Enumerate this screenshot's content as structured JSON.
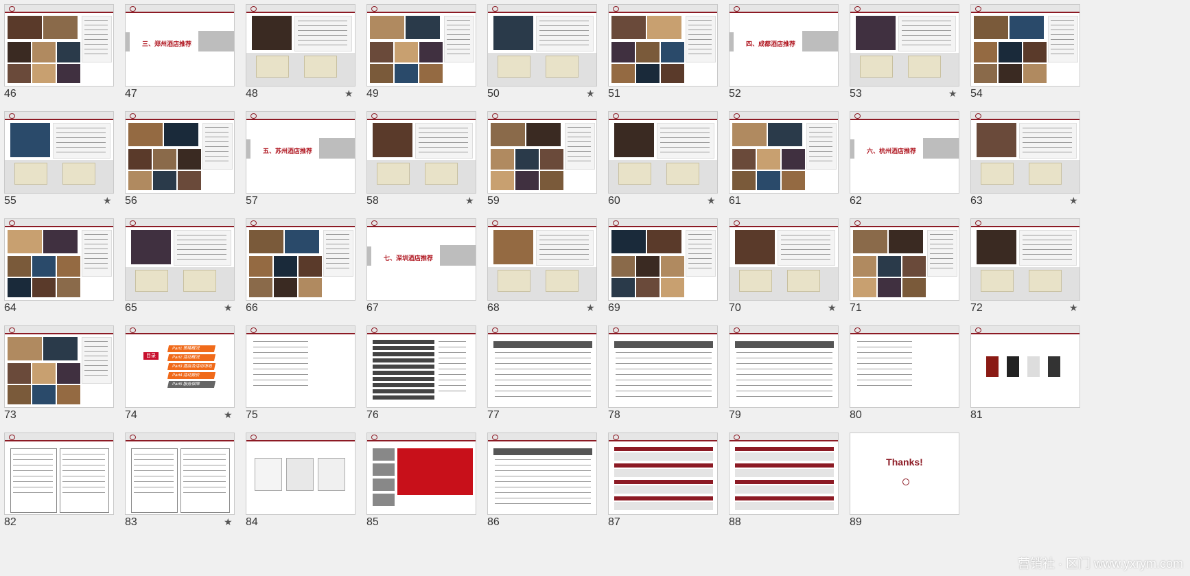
{
  "watermark": "营销社 · 区门 www.yxrym.com",
  "section_titles": {
    "47": "三、郑州酒店推荐",
    "52": "四、成都酒店推荐",
    "57": "五、苏州酒店推荐",
    "62": "六、杭州酒店推荐",
    "67": "七、深圳酒店推荐"
  },
  "thanks_text": "Thanks!",
  "toc": {
    "label": "目录",
    "items": [
      "Part1 策略概况",
      "Part2 活动概况",
      "Part3 酒店及活动场地",
      "Part4 活动报价",
      "Part5 服务保障"
    ]
  },
  "slides": [
    {
      "n": "46",
      "star": false,
      "kind": "photos"
    },
    {
      "n": "47",
      "star": false,
      "kind": "section"
    },
    {
      "n": "48",
      "star": true,
      "kind": "hotel"
    },
    {
      "n": "49",
      "star": false,
      "kind": "photos"
    },
    {
      "n": "50",
      "star": true,
      "kind": "hotel"
    },
    {
      "n": "51",
      "star": false,
      "kind": "photos"
    },
    {
      "n": "52",
      "star": false,
      "kind": "section"
    },
    {
      "n": "53",
      "star": true,
      "kind": "hotel"
    },
    {
      "n": "54",
      "star": false,
      "kind": "photos"
    },
    {
      "n": "55",
      "star": true,
      "kind": "hotel"
    },
    {
      "n": "56",
      "star": false,
      "kind": "photos"
    },
    {
      "n": "57",
      "star": false,
      "kind": "section"
    },
    {
      "n": "58",
      "star": true,
      "kind": "hotel"
    },
    {
      "n": "59",
      "star": false,
      "kind": "photos"
    },
    {
      "n": "60",
      "star": true,
      "kind": "hotel"
    },
    {
      "n": "61",
      "star": false,
      "kind": "photos"
    },
    {
      "n": "62",
      "star": false,
      "kind": "section"
    },
    {
      "n": "63",
      "star": true,
      "kind": "hotel"
    },
    {
      "n": "64",
      "star": false,
      "kind": "photos"
    },
    {
      "n": "65",
      "star": true,
      "kind": "hotel"
    },
    {
      "n": "66",
      "star": false,
      "kind": "photos"
    },
    {
      "n": "67",
      "star": false,
      "kind": "section"
    },
    {
      "n": "68",
      "star": true,
      "kind": "hotel"
    },
    {
      "n": "69",
      "star": false,
      "kind": "photos"
    },
    {
      "n": "70",
      "star": true,
      "kind": "hotel"
    },
    {
      "n": "71",
      "star": false,
      "kind": "photos"
    },
    {
      "n": "72",
      "star": true,
      "kind": "hotel"
    },
    {
      "n": "73",
      "star": false,
      "kind": "photos"
    },
    {
      "n": "74",
      "star": true,
      "kind": "toc"
    },
    {
      "n": "75",
      "star": false,
      "kind": "text"
    },
    {
      "n": "76",
      "star": false,
      "kind": "list"
    },
    {
      "n": "77",
      "star": false,
      "kind": "table"
    },
    {
      "n": "78",
      "star": false,
      "kind": "table"
    },
    {
      "n": "79",
      "star": false,
      "kind": "table"
    },
    {
      "n": "80",
      "star": false,
      "kind": "text"
    },
    {
      "n": "81",
      "star": false,
      "kind": "products"
    },
    {
      "n": "82",
      "star": false,
      "kind": "boxes"
    },
    {
      "n": "83",
      "star": true,
      "kind": "boxes"
    },
    {
      "n": "84",
      "star": false,
      "kind": "docs"
    },
    {
      "n": "85",
      "star": false,
      "kind": "redtext"
    },
    {
      "n": "86",
      "star": false,
      "kind": "table"
    },
    {
      "n": "87",
      "star": false,
      "kind": "bars"
    },
    {
      "n": "88",
      "star": false,
      "kind": "bars"
    },
    {
      "n": "89",
      "star": false,
      "kind": "thanks"
    }
  ],
  "star_glyph": "★"
}
